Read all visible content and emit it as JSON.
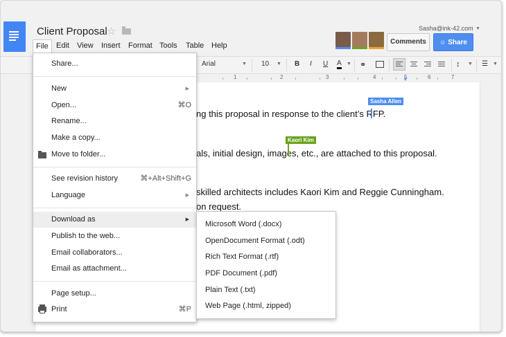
{
  "document": {
    "title": "Client Proposal"
  },
  "menubar": {
    "items": [
      "File",
      "Edit",
      "View",
      "Insert",
      "Format",
      "Tools",
      "Table",
      "Help"
    ]
  },
  "account": {
    "email": "Sasha@ink-42.com"
  },
  "buttons": {
    "comments": "Comments",
    "share": "Share"
  },
  "toolbar": {
    "font": "Arial",
    "font_size": "10",
    "bold": "B",
    "italic": "I",
    "underline": "U",
    "text_color": "A"
  },
  "ruler": {
    "numbers": [
      "1",
      "2",
      "3",
      "4",
      "5",
      "6",
      "7"
    ]
  },
  "doc_lines": {
    "line1": "ng this proposal in response to the client’s RFP.",
    "line2": "als, initial design, images, etc., are attached to this proposal.",
    "line3": "skilled architects includes Kaori Kim and Reggie Cunningham.",
    "line4": "on request."
  },
  "collaborators": {
    "sasha": {
      "label": "Sasha Allen",
      "color": "#4d8ef0"
    },
    "kaori": {
      "label": "Kaori Kim",
      "color": "#6aa31e"
    }
  },
  "file_menu": {
    "share": "Share...",
    "new": "New",
    "open": "Open...",
    "open_shortcut": "⌘O",
    "rename": "Rename...",
    "make_copy": "Make a copy...",
    "move_to_folder": "Move to folder...",
    "revision_history": "See revision history",
    "revision_shortcut": "⌘+Alt+Shift+G",
    "language": "Language",
    "download_as": "Download as",
    "publish": "Publish to the web...",
    "email_collaborators": "Email collaborators...",
    "email_attachment": "Email as attachment...",
    "page_setup": "Page setup...",
    "print": "Print",
    "print_shortcut": "⌘P"
  },
  "download_menu": {
    "items": [
      "Microsoft Word (.docx)",
      "OpenDocument Format (.odt)",
      "Rich Text Format (.rtf)",
      "PDF Document (.pdf)",
      "Plain Text (.txt)",
      "Web Page (.html, zipped)"
    ]
  },
  "colors": {
    "accent": "#4285f4",
    "share_button": "#4d8ef0",
    "sasha_cursor": "#4d8ef0",
    "kaori_cursor": "#6aa31e"
  }
}
